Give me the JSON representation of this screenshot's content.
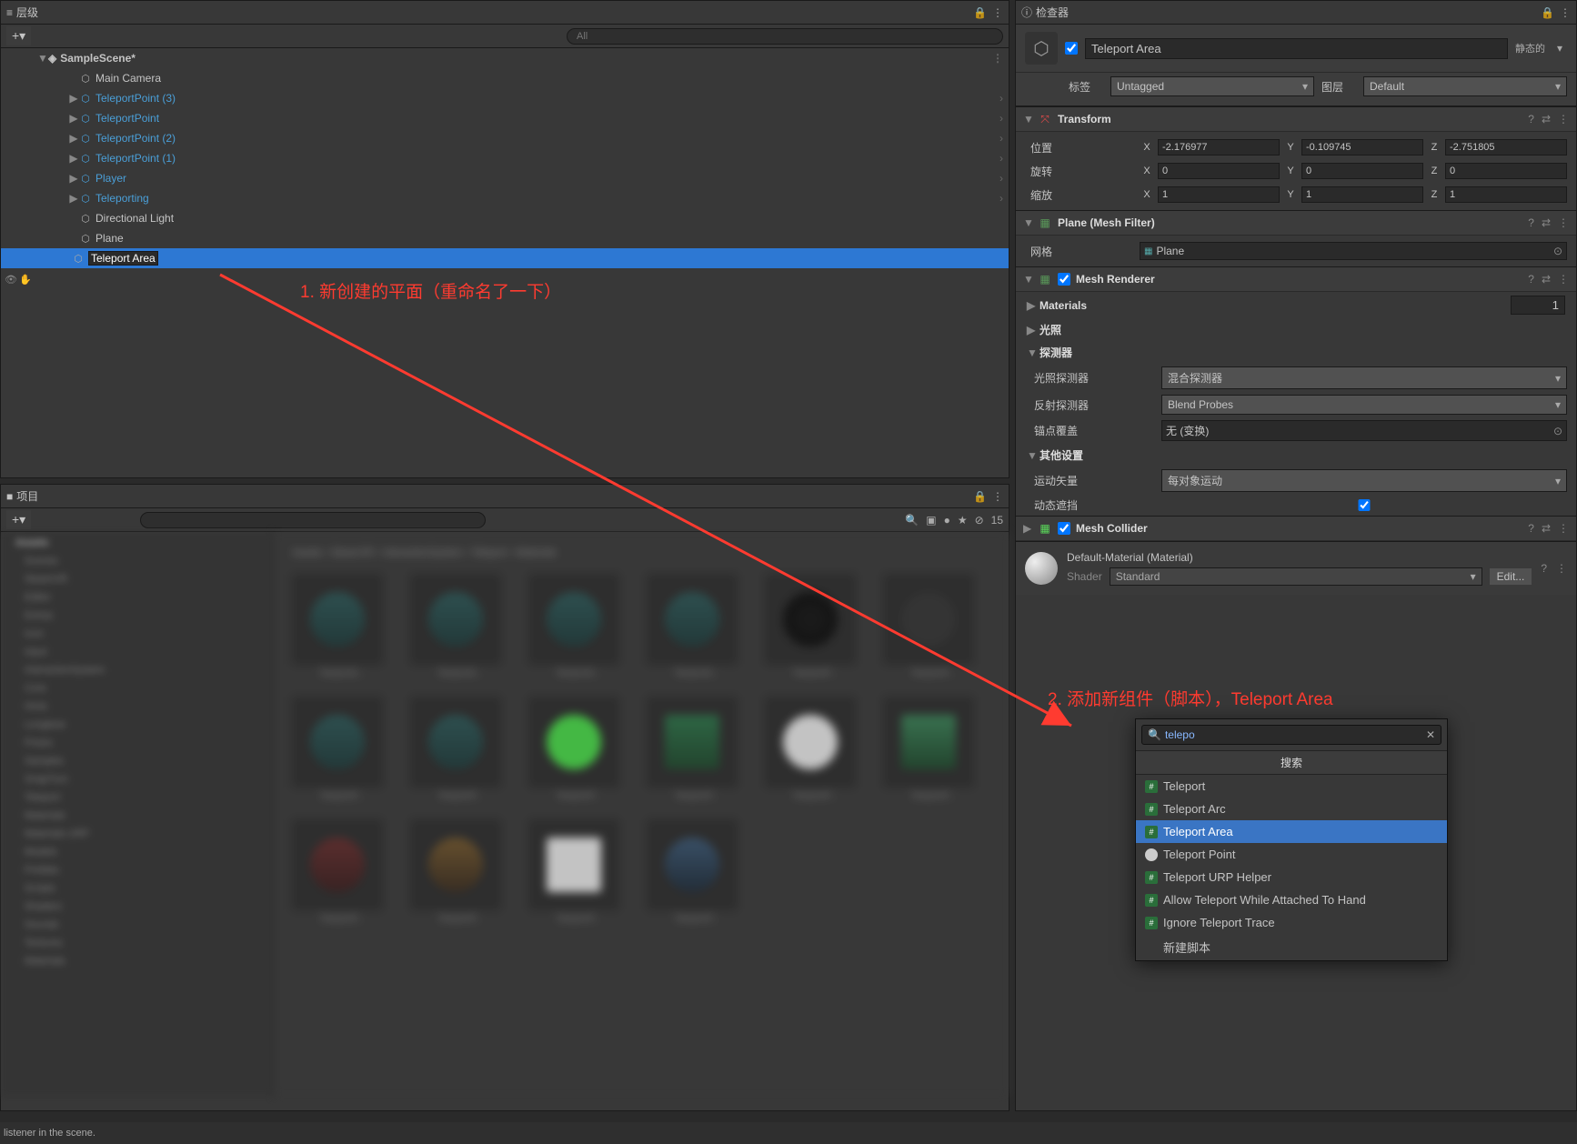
{
  "hierarchy": {
    "title": "层级",
    "search_placeholder": "All",
    "scene": "SampleScene*",
    "items": [
      {
        "label": "Main Camera",
        "blue": false,
        "icon": "grey",
        "indent": 1,
        "chev": false
      },
      {
        "label": "TeleportPoint (3)",
        "blue": true,
        "icon": "blue",
        "indent": 1,
        "chev": true
      },
      {
        "label": "TeleportPoint",
        "blue": true,
        "icon": "blue",
        "indent": 1,
        "chev": true
      },
      {
        "label": "TeleportPoint (2)",
        "blue": true,
        "icon": "blue",
        "indent": 1,
        "chev": true
      },
      {
        "label": "TeleportPoint (1)",
        "blue": true,
        "icon": "blue",
        "indent": 1,
        "chev": true
      },
      {
        "label": "Player",
        "blue": true,
        "icon": "blue",
        "indent": 1,
        "chev": true
      },
      {
        "label": "Teleporting",
        "blue": true,
        "icon": "blue",
        "indent": 1,
        "chev": true
      },
      {
        "label": "Directional Light",
        "blue": false,
        "icon": "grey",
        "indent": 1,
        "chev": false
      },
      {
        "label": "Plane",
        "blue": false,
        "icon": "grey",
        "indent": 1,
        "chev": false
      }
    ],
    "selected": {
      "label": "Teleport Area",
      "icon": "grey",
      "indent": 1
    }
  },
  "project": {
    "title": "项目",
    "hidden_count": "15",
    "crumb": [
      "Assets",
      "SteamVR",
      "InteractionSystem",
      "Teleport",
      "Materials"
    ]
  },
  "inspector": {
    "title": "检查器",
    "checked": true,
    "object_name": "Teleport Area",
    "static_label": "静态的",
    "tag_label": "标签",
    "tag_value": "Untagged",
    "layer_label": "图层",
    "layer_value": "Default",
    "transform": {
      "title": "Transform",
      "pos_label": "位置",
      "rot_label": "旋转",
      "scale_label": "缩放",
      "px": "-2.176977",
      "py": "-0.109745",
      "pz": "-2.751805",
      "rx": "0",
      "ry": "0",
      "rz": "0",
      "sx": "1",
      "sy": "1",
      "sz": "1"
    },
    "mesh_filter": {
      "title": "Plane (Mesh Filter)",
      "mesh_label": "网格",
      "mesh_value": "Plane"
    },
    "mesh_renderer": {
      "title": "Mesh Renderer",
      "materials": "Materials",
      "materials_count": "1",
      "lighting": "光照",
      "probes": "探测器",
      "light_probes_label": "光照探测器",
      "light_probes_value": "混合探测器",
      "refl_probes_label": "反射探测器",
      "refl_probes_value": "Blend Probes",
      "anchor_label": "锚点覆盖",
      "anchor_value": "无 (变换)",
      "additional": "其他设置",
      "motion_label": "运动矢量",
      "motion_value": "每对象运动",
      "dynocc_label": "动态遮挡"
    },
    "mesh_collider": {
      "title": "Mesh Collider"
    },
    "material": {
      "name": "Default-Material (Material)",
      "shader_label": "Shader",
      "shader_value": "Standard",
      "edit": "Edit..."
    },
    "popup": {
      "search": "telepo",
      "section": "搜索",
      "items": [
        {
          "label": "Teleport",
          "icon": "script"
        },
        {
          "label": "Teleport Arc",
          "icon": "script"
        },
        {
          "label": "Teleport Area",
          "icon": "script",
          "selected": true
        },
        {
          "label": "Teleport Point",
          "icon": "steam"
        },
        {
          "label": "Teleport URP Helper",
          "icon": "script"
        },
        {
          "label": "Allow Teleport While Attached To Hand",
          "icon": "script"
        },
        {
          "label": "Ignore Teleport Trace",
          "icon": "script"
        }
      ],
      "new_script": "新建脚本"
    }
  },
  "annotations": {
    "a1": "1. 新创建的平面（重命名了一下）",
    "a2": "2. 添加新组件（脚本），Teleport Area"
  },
  "console": "listener in the scene."
}
